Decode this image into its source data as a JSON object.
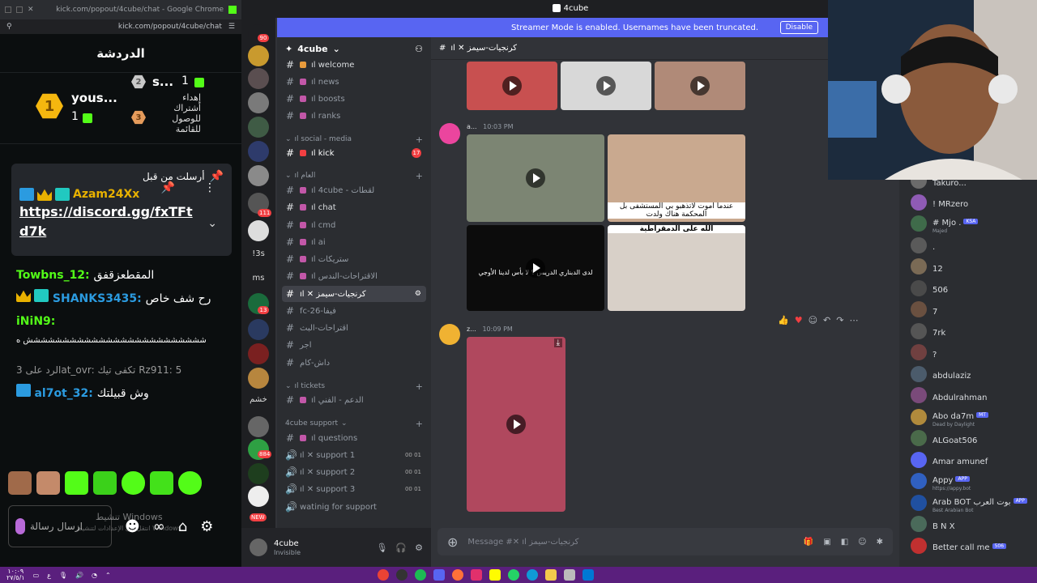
{
  "browser": {
    "title": "kick.com/popout/4cube/chat - Google Chrome",
    "url": "kick.com/popout/4cube/chat"
  },
  "kick_chat": {
    "header": "الدردشة",
    "leaderboard": {
      "first_name": "yous...",
      "first_rank": "1",
      "first_count": "1",
      "second_name": "s...",
      "second_rank": "2",
      "second_count": "1",
      "third_rank": "3",
      "third_text": "إهداء\nأشتراك\nللوصول\nللقائمة"
    },
    "pinned": {
      "label": "أرسلت من قبل",
      "user": "Azam24Xx",
      "link": "https://discord.gg/fxTFtd7k"
    },
    "messages": [
      {
        "user": "Towbns_12",
        "text": "المقطعزقفق",
        "color": "#53fc18"
      },
      {
        "user": "SHANKS3435",
        "text": "رح شف خاص",
        "color": "#2b9be0"
      },
      {
        "user": "iNiN9",
        "text": "ششششششششششششششششششششششششش ه",
        "color": "#53fc18"
      },
      {
        "user": "al7ot_32",
        "text": "وش قبيلتك",
        "color": "#2b9be0"
      }
    ],
    "reply_hint": "الرد على 3at_ovr: تكفى تيك Rz911: 5",
    "send_placeholder": "ارسال رسالة",
    "activate_windows": "تنشيط Windows",
    "activate_windows_sub": "انتقل إلى الإعدادات لتنشيط Windows."
  },
  "discord": {
    "window_title": "4cube",
    "banner_text": "Streamer Mode is enabled. Usernames have been truncated.",
    "banner_button": "Disable",
    "server_name": "4cube",
    "server_badges": [
      "90",
      "111",
      "13",
      "884",
      "NEW"
    ],
    "server_labels": [
      "!3s",
      "ms",
      "خشم"
    ],
    "channels_top": [
      {
        "name": "ıl welcome"
      },
      {
        "name": "ıl news"
      },
      {
        "name": "ıl boosts"
      },
      {
        "name": "ıl ranks"
      }
    ],
    "cat_social": "ıl social - media",
    "kick_channel": "ıl kick",
    "kick_mentions": "17",
    "cat_general": "ıl العام",
    "channels_general": [
      {
        "name": "ıl 4cube - لقطات"
      },
      {
        "name": "ıl chat"
      },
      {
        "name": "ıl cmd"
      },
      {
        "name": "ıl ai"
      },
      {
        "name": "ıl ستريكات"
      },
      {
        "name": "ıl الاقتراحات-الندس"
      },
      {
        "name": "ıl ✕ كرنجيات-سيمز"
      },
      {
        "name": "fc-26-فيفا"
      },
      {
        "name": "اقتراحات-البث"
      },
      {
        "name": "اجر"
      },
      {
        "name": "داش-كام"
      }
    ],
    "cat_tickets": "ıl tickets",
    "tickets_channel": "ıl الدعم - الفني",
    "cat_support": "4cube support",
    "support_channels": [
      {
        "name": "ıl questions"
      },
      {
        "name": "ıl ✕ support 1",
        "count": "00 01"
      },
      {
        "name": "ıl ✕ support 2",
        "count": "00 01"
      },
      {
        "name": "ıl ✕ support 3",
        "count": "00 01"
      },
      {
        "name": "watinig for support"
      }
    ],
    "user_name": "4cube",
    "user_status": "Invisible",
    "channel_header": "ıl ✕ كرنجيات-سيمز",
    "message1_author": "a...",
    "message1_time": "10:03 PM",
    "message1_caption_top": "عندما اموت لاتذهبو بي المستشفى بل المحكمة هناك ولدت",
    "message1_caption_mid": "الله على الدمقراطية",
    "message1_video_text": "لدى الدبناري الدريس ؟ لا بأس لدينا الأوجي",
    "message2_author": "z...",
    "message2_time": "10:09 PM",
    "composer_placeholder": "Message #✕ ıl كرنجيات-سيمز"
  },
  "members": [
    {
      "name": "Takuro..."
    },
    {
      "name": "! MRzero"
    },
    {
      "name": "# Mjo .",
      "tag": "KSA",
      "sub": "Majed"
    },
    {
      "name": "."
    },
    {
      "name": "12"
    },
    {
      "name": "506"
    },
    {
      "name": "7"
    },
    {
      "name": "7rk"
    },
    {
      "name": "?"
    },
    {
      "name": "abdulaziz"
    },
    {
      "name": "Abdulrahman"
    },
    {
      "name": "Abo da7m",
      "tag": "MT",
      "sub": "Dead by Daylight"
    },
    {
      "name": "ALGoat506"
    },
    {
      "name": "Amar amunef"
    },
    {
      "name": "Appy",
      "tag": "APP",
      "sub": "https://appy.bot"
    },
    {
      "name": "Arab BOT بوت العرب",
      "tag": "APP",
      "sub": "Best Arabian Bot"
    },
    {
      "name": "B N X"
    },
    {
      "name": "Better call me",
      "tag": "506"
    }
  ],
  "taskbar": {
    "time": "١٠:٠٩",
    "date": "٢٧/٥/١"
  },
  "colors": {
    "kick_green": "#53fc18",
    "discord_blurple": "#5865f2",
    "taskbar_purple": "#5a1f7d"
  }
}
